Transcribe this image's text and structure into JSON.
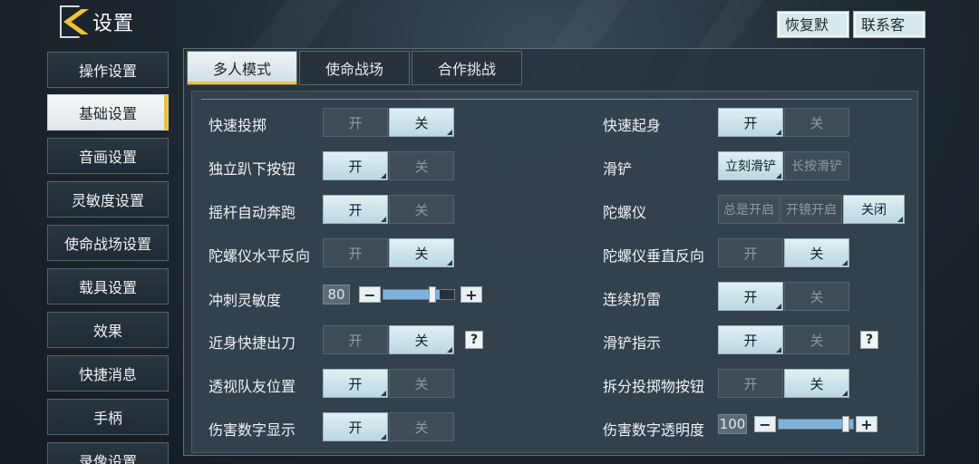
{
  "header": {
    "title": "设置",
    "restore_label": "恢复默认",
    "contact_label": "联系客服"
  },
  "sidebar": {
    "items": [
      {
        "label": "操作设置"
      },
      {
        "label": "基础设置"
      },
      {
        "label": "音画设置"
      },
      {
        "label": "灵敏度设置"
      },
      {
        "label": "使命战场设置"
      },
      {
        "label": "载具设置"
      },
      {
        "label": "效果"
      },
      {
        "label": "快捷消息"
      },
      {
        "label": "手柄"
      },
      {
        "label": "录像设置"
      }
    ],
    "active": "基础设置"
  },
  "tabs": [
    {
      "label": "多人模式"
    },
    {
      "label": "使命战场"
    },
    {
      "label": "合作挑战"
    }
  ],
  "active_tab": "多人模式",
  "settings_left": [
    {
      "label": "快速投掷",
      "options": [
        "开",
        "关"
      ],
      "selected": "关"
    },
    {
      "label": "独立趴下按钮",
      "options": [
        "开",
        "关"
      ],
      "selected": "开"
    },
    {
      "label": "摇杆自动奔跑",
      "options": [
        "开",
        "关"
      ],
      "selected": "开"
    },
    {
      "label": "陀螺仪水平反向",
      "options": [
        "开",
        "关"
      ],
      "selected": "关"
    },
    {
      "label": "冲刺灵敏度",
      "value": "80",
      "min_icon": "−",
      "plus_icon": "+",
      "fraction": 0.8
    },
    {
      "label": "近身快捷出刀",
      "options": [
        "开",
        "关"
      ],
      "selected": "关",
      "help": "?"
    },
    {
      "label": "透视队友位置",
      "options": [
        "开",
        "关"
      ],
      "selected": "开"
    },
    {
      "label": "伤害数字显示",
      "options": [
        "开",
        "关"
      ],
      "selected": "开"
    }
  ],
  "settings_right": [
    {
      "label": "快速起身",
      "options": [
        "开",
        "关"
      ],
      "selected": "开"
    },
    {
      "label": "滑铲",
      "options": [
        "立刻滑铲",
        "长按滑铲"
      ],
      "selected": "立刻滑铲"
    },
    {
      "label": "陀螺仪",
      "options": [
        "总是开启",
        "开镜开启",
        "关闭"
      ],
      "selected": "关闭"
    },
    {
      "label": "陀螺仪垂直反向",
      "options": [
        "开",
        "关"
      ],
      "selected": "关"
    },
    {
      "label": "连续扔雷",
      "options": [
        "开",
        "关"
      ],
      "selected": "开"
    },
    {
      "label": "滑铲指示",
      "options": [
        "开",
        "关"
      ],
      "selected": "开",
      "help": "?"
    },
    {
      "label": "拆分投掷物按钮",
      "options": [
        "开",
        "关"
      ],
      "selected": "关"
    },
    {
      "label": "伤害数字透明度",
      "value": "100",
      "min_icon": "−",
      "plus_icon": "+",
      "fraction": 1.0
    }
  ],
  "colors": {
    "accent": "#f2c230",
    "selected_bg": "#cfe5eb",
    "slider_fill": "#7fb2da"
  }
}
